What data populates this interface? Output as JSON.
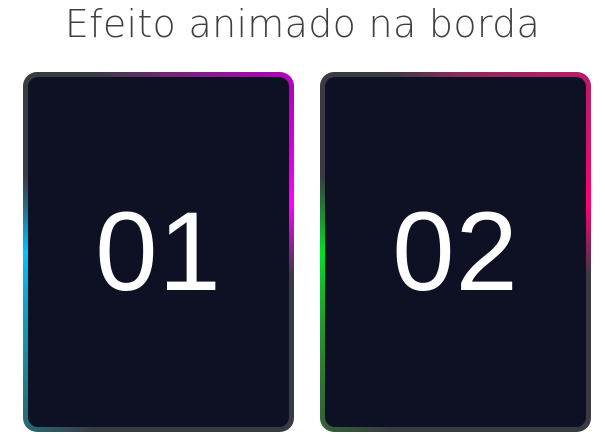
{
  "page": {
    "title": "Efeito animado na borda"
  },
  "cards": [
    {
      "number": "01",
      "border_colors": [
        "#00c3ff",
        "#ff00ff"
      ],
      "background": "#0d1123"
    },
    {
      "number": "02",
      "border_colors": [
        "#00e025",
        "#ff0070"
      ],
      "background": "#0d1123"
    }
  ]
}
